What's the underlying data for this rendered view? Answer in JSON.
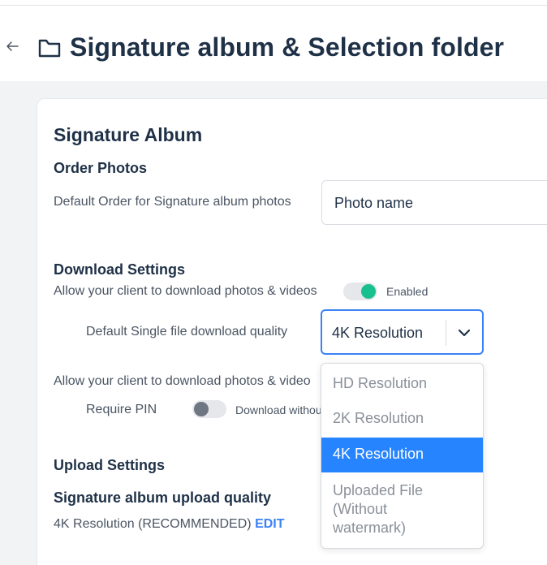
{
  "header": {
    "title": "Signature album & Selection folder"
  },
  "signature_album": {
    "heading": "Signature Album",
    "order_photos": {
      "heading": "Order Photos",
      "label": "Default Order for Signature album photos",
      "value": "Photo name"
    }
  },
  "download_settings": {
    "heading": "Download Settings",
    "allow_label": "Allow your client to download photos & videos",
    "allow_toggle": {
      "state": "Enabled",
      "on": true
    },
    "single_quality_label": "Default Single file download quality",
    "single_quality_value": "4K Resolution",
    "allow_label_2": "Allow your client to download photos & video",
    "require_pin_label": "Require PIN",
    "require_pin_toggle": {
      "state": "Download withou",
      "on": false
    },
    "dropdown_options": [
      "HD Resolution",
      "2K Resolution",
      "4K Resolution",
      "Uploaded File\n(Without\nwatermark)"
    ],
    "dropdown_selected": "4K Resolution"
  },
  "upload_settings": {
    "heading": "Upload Settings",
    "quality_heading": "Signature album upload quality",
    "quality_value": "4K Resolution (RECOMMENDED)",
    "edit_label": "EDIT"
  },
  "colors": {
    "accent": "#3b82f6",
    "toggle_on": "#18c08f",
    "selected_option": "#2684ff"
  }
}
